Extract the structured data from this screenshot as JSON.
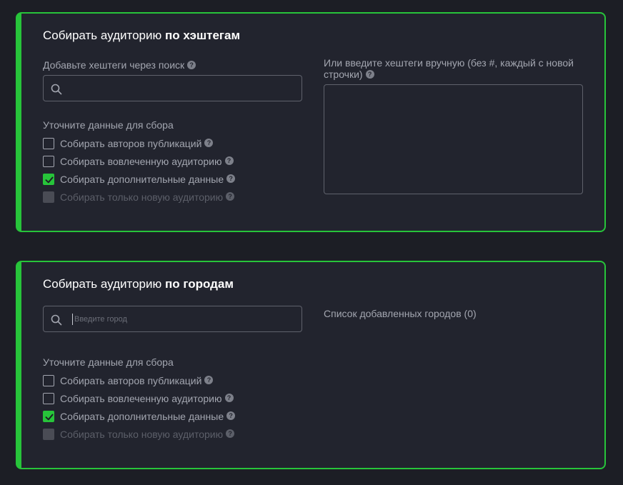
{
  "hashtags_card": {
    "title_prefix": "Собирать аудиторию ",
    "title_bold": "по хэштегам",
    "search_label": "Добавьте хештеги через поиск",
    "search_value": "",
    "manual_label_line1": "Или введите хештеги вручную (без #, каждый с новой",
    "manual_label_line2": "строчки)",
    "manual_value": "",
    "options_label": "Уточните данные для сбора",
    "options": [
      {
        "label": "Собирать авторов публикаций",
        "checked": false,
        "disabled": false
      },
      {
        "label": "Собирать вовлеченную аудиторию",
        "checked": false,
        "disabled": false
      },
      {
        "label": "Собирать дополнительные данные",
        "checked": true,
        "disabled": false
      },
      {
        "label": "Собирать только новую аудиторию",
        "checked": false,
        "disabled": true
      }
    ]
  },
  "cities_card": {
    "title_prefix": "Собирать аудиторию ",
    "title_bold": "по городам",
    "search_placeholder": "Введите город",
    "search_value": "",
    "added_list_label": "Список добавленных городов (0)",
    "options_label": "Уточните данные для сбора",
    "options": [
      {
        "label": "Собирать авторов публикаций",
        "checked": false,
        "disabled": false
      },
      {
        "label": "Собирать вовлеченную аудиторию",
        "checked": false,
        "disabled": false
      },
      {
        "label": "Собирать дополнительные данные",
        "checked": true,
        "disabled": false
      },
      {
        "label": "Собирать только новую аудиторию",
        "checked": false,
        "disabled": true
      }
    ]
  },
  "icons": {
    "help": "?",
    "search": "search-icon",
    "check": "check-icon"
  },
  "colors": {
    "accent": "#27c43a",
    "card_bg": "#22242e",
    "page_bg": "#1c1e25"
  }
}
